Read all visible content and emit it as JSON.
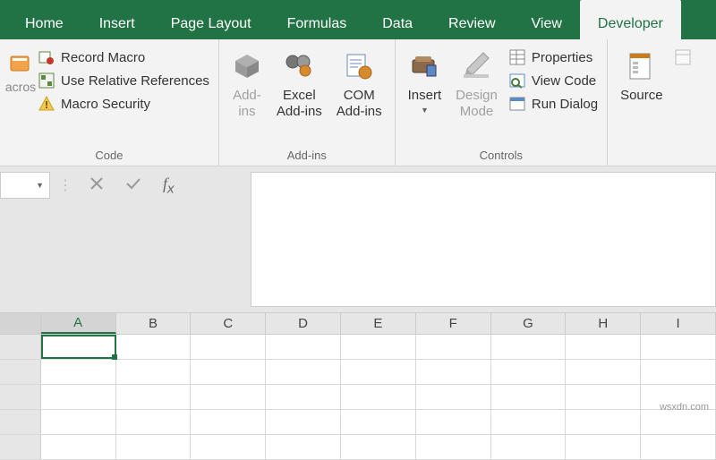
{
  "tabs": [
    "Home",
    "Insert",
    "Page Layout",
    "Formulas",
    "Data",
    "Review",
    "View",
    "Developer"
  ],
  "activeTab": "Developer",
  "code": {
    "vb_label_line1": "",
    "vb_label_line2": "",
    "macros_label": "acros",
    "record": "Record Macro",
    "relative": "Use Relative References",
    "security": "Macro Security",
    "group": "Code"
  },
  "addins": {
    "addins_l1": "Add-",
    "addins_l2": "ins",
    "excel_l1": "Excel",
    "excel_l2": "Add-ins",
    "com_l1": "COM",
    "com_l2": "Add-ins",
    "group": "Add-ins"
  },
  "controls": {
    "insert": "Insert",
    "design_l1": "Design",
    "design_l2": "Mode",
    "properties": "Properties",
    "viewcode": "View Code",
    "rundialog": "Run Dialog",
    "group": "Controls"
  },
  "xml": {
    "source": "Source"
  },
  "columns": [
    "A",
    "B",
    "C",
    "D",
    "E",
    "F",
    "G",
    "H",
    "I"
  ],
  "activeColumn": "A",
  "watermark": "wsxdn.com"
}
